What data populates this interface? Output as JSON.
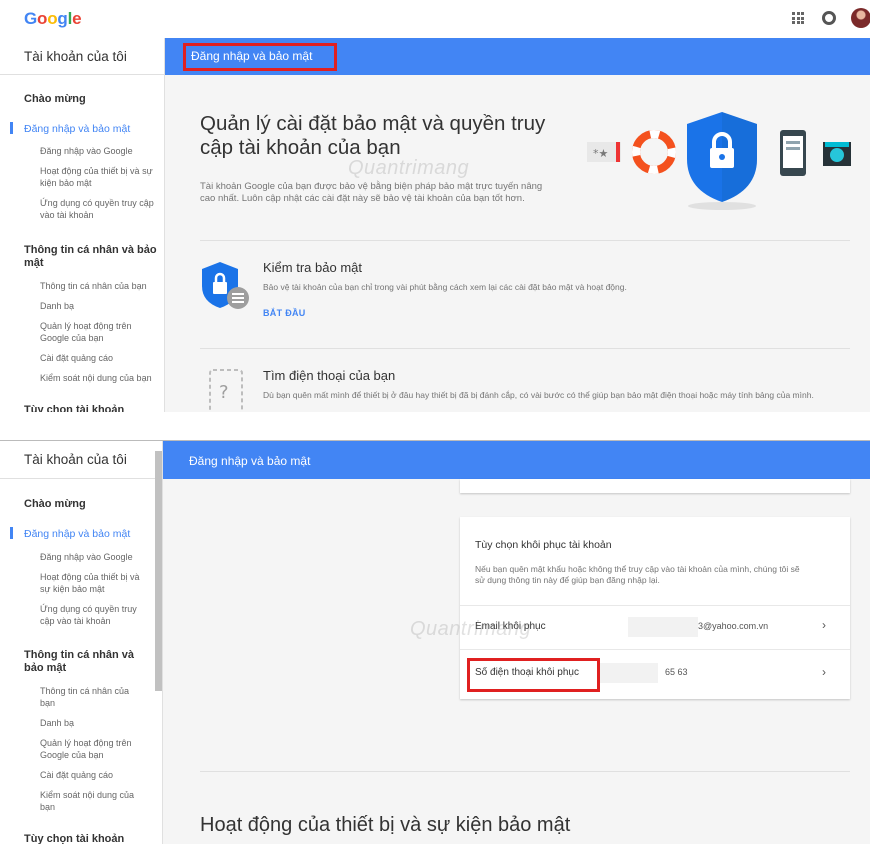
{
  "app": {
    "logo": "Google"
  },
  "header_icons": [
    "apps-grid-icon",
    "notifications-icon",
    "avatar"
  ],
  "sidebar": {
    "title": "Tài khoản của tôi",
    "welcome": "Chào mừng",
    "active": "Đăng nhập và bảo mật",
    "sub_security": [
      "Đăng nhập vào Google",
      "Hoạt động của thiết bị và sự kiện bảo mật",
      "Ứng dụng có quyền truy cập vào tài khoản"
    ],
    "personal_section": "Thông tin cá nhân và bảo mật",
    "sub_personal": [
      "Thông tin cá nhân của bạn",
      "Danh bạ",
      "Quản lý hoạt động trên Google của bạn",
      "Cài đặt quảng cáo",
      "Kiểm soát nội dung của bạn"
    ],
    "account_prefs": "Tùy chọn tài khoản"
  },
  "bluebar": {
    "title": "Đăng nhập và bảo mật"
  },
  "hero": {
    "title": "Quản lý cài đặt bảo mật và quyền truy cập tài khoản của bạn",
    "desc": "Tài khoản Google của bạn được bảo vệ bằng biện pháp bảo mật trực tuyến nâng cao nhất. Luôn cập nhật các cài đặt này sẽ bảo vệ tài khoản của bạn tốt hơn."
  },
  "security_check": {
    "title": "Kiểm tra bảo mật",
    "desc": "Bảo vệ tài khoản của bạn chỉ trong vài phút bằng cách xem lại các cài đặt bảo mật và hoạt động.",
    "cta": "BẮT ĐẦU"
  },
  "find_phone": {
    "title": "Tìm điện thoại của bạn",
    "desc": "Dù bạn quên mất mình để thiết bị ở đâu hay thiết bị đã bị đánh cắp, có vài bước có thể giúp bạn bảo mật điện thoại hoặc máy tính bảng của mình."
  },
  "recovery": {
    "title": "Tùy chọn khôi phục tài khoản",
    "desc": "Nếu bạn quên mật khẩu hoặc không thể truy cập vào tài khoản của mình, chúng tôi sẽ sử dụng thông tin này để giúp bạn đăng nhập lại.",
    "email_label": "Email khôi phục",
    "email_value": "3@yahoo.com.vn",
    "phone_label": "Số điện thoại khôi phục",
    "phone_value": "65 63"
  },
  "device_activity": {
    "title": "Hoạt động của thiết bị và sự kiện bảo mật"
  },
  "watermark": "Quantrimang",
  "colors": {
    "accent": "#4285f4",
    "highlight": "#e02020",
    "shield": "#1a73e8"
  }
}
